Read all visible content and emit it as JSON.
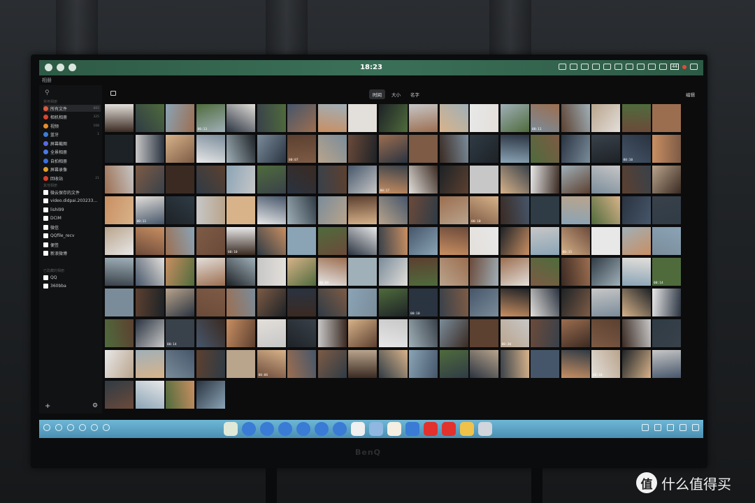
{
  "statusbar": {
    "time": "18:23",
    "battery": "44"
  },
  "app": {
    "title": "相册"
  },
  "sidebar": {
    "section_1": "常用相册",
    "items_1": [
      {
        "label": "所有文件",
        "count": "885",
        "color": "#e05a3c"
      },
      {
        "label": "相机相册",
        "count": "325",
        "color": "#d9452f"
      },
      {
        "label": "视频",
        "count": "168",
        "color": "#e88b2c"
      },
      {
        "label": "蓝牙",
        "count": "1",
        "color": "#3f7ddc"
      },
      {
        "label": "屏幕截图",
        "count": "",
        "color": "#5a6be0"
      },
      {
        "label": "全景相册",
        "count": "",
        "color": "#4b78e6"
      },
      {
        "label": "自拍相册",
        "count": "",
        "color": "#3b6fe0"
      },
      {
        "label": "屏幕录像",
        "count": "",
        "color": "#e0a02e"
      },
      {
        "label": "回收站",
        "count": "21",
        "color": "#d9402d"
      }
    ],
    "section_2": "其他相册",
    "items_2": [
      {
        "label": "微云保存的文件",
        "count": "",
        "color": "#ffffff"
      },
      {
        "label": "video.didpai.203233...",
        "count": "",
        "color": "#ffffff"
      },
      {
        "label": "lishi99",
        "count": "",
        "color": "#ffffff"
      },
      {
        "label": "DCIM",
        "count": "",
        "color": "#ffffff"
      },
      {
        "label": "微信",
        "count": "",
        "color": "#ffffff"
      },
      {
        "label": "QQfile_recv",
        "count": "",
        "color": "#ffffff"
      },
      {
        "label": "便签",
        "count": "",
        "color": "#ffffff"
      },
      {
        "label": "新浪微博",
        "count": "",
        "color": "#ffffff"
      }
    ],
    "section_3": "已隐藏的相册",
    "items_3": [
      {
        "label": "QQ",
        "count": "",
        "color": "#ffffff"
      },
      {
        "label": "360bba",
        "count": "",
        "color": "#ffffff"
      }
    ]
  },
  "toolbar": {
    "tabs": [
      "时间",
      "大小",
      "名字"
    ],
    "active_tab": 0,
    "edit": "编辑"
  },
  "durations": [
    "00:13",
    "00:11",
    "00:07",
    "00:10",
    "00:17",
    "00:11",
    "00:10",
    "00:10",
    "00:15",
    "00:08",
    "00:14",
    "00:10",
    "00:14",
    "00:30",
    "00:06",
    "00:10"
  ],
  "watermark": {
    "logo": "值",
    "text": "什么值得买"
  },
  "monitor_brand": "BenQ",
  "colors": {
    "statusbar": "#3b7058",
    "dock": "#5aa3c6",
    "accent_red": "#e14a3b"
  }
}
